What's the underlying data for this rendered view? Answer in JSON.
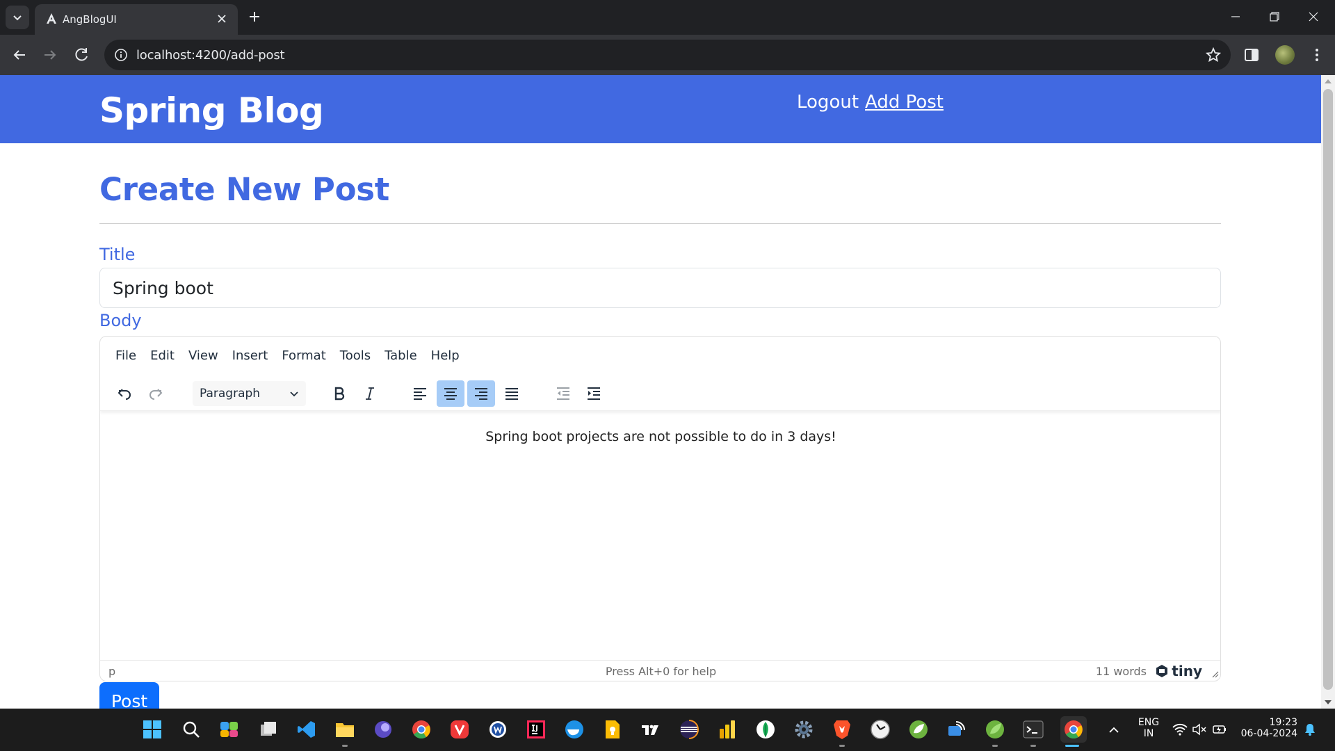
{
  "browser": {
    "tab_title": "AngBlogUI",
    "url": "localhost:4200/add-post"
  },
  "site": {
    "brand": "Spring Blog",
    "nav": {
      "logout": "Logout",
      "add_post": "Add Post"
    }
  },
  "form": {
    "page_title": "Create New Post",
    "title_label": "Title",
    "title_value": "Spring boot",
    "body_label": "Body",
    "submit_label": "Post"
  },
  "editor": {
    "menu": [
      "File",
      "Edit",
      "View",
      "Insert",
      "Format",
      "Tools",
      "Table",
      "Help"
    ],
    "block_format": "Paragraph",
    "content": "Spring boot projects are not possible to do in 3 days!",
    "status_path": "p",
    "status_help": "Press Alt+0 for help",
    "word_count": "11 words",
    "brand": "tiny",
    "active_alignment": "align-center"
  },
  "taskbar": {
    "apps": [
      "start",
      "search",
      "copilot-pre",
      "task-view",
      "vscode",
      "file-explorer",
      "eclipse-purple",
      "chrome",
      "vivaldi",
      "word-w",
      "intellij",
      "docker",
      "google-keep",
      "tradingview",
      "eclipse",
      "power-bi",
      "mongodb-compass",
      "settings",
      "brave",
      "clock",
      "spring-tools",
      "remote-desktop",
      "spring-boot",
      "terminal",
      "chrome-active"
    ],
    "language_line1": "ENG",
    "language_line2": "IN",
    "time": "19:23",
    "date": "06-04-2024"
  },
  "colors": {
    "brand_blue": "#4169e1",
    "button_blue": "#0d6efd",
    "active_tool": "#a6ccf7"
  }
}
